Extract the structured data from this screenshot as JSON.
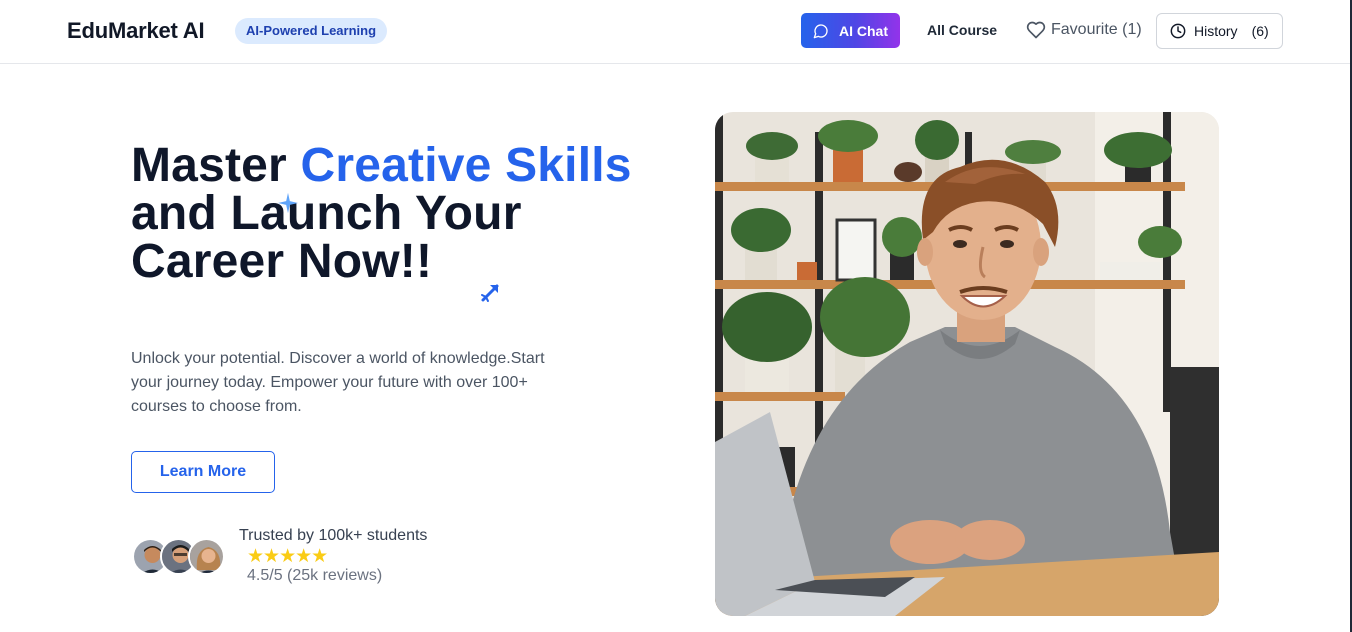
{
  "nav": {
    "brand": "EduMarket AI",
    "tagline": "AI-Powered Learning",
    "ai_chat_label": "AI Chat",
    "all_course_label": "All Course",
    "favourite_label": "Favourite (1)",
    "history_label": "History",
    "history_count": "(6)"
  },
  "hero": {
    "headline_part1": "Master ",
    "headline_accent": "Creative Skills",
    "headline_part2": "and Launch Your Career Now!!",
    "subtext": "Unlock your potential. Discover a world of knowledge.Start your journey today. Empower your future with over 100+ courses to choose from.",
    "cta_label": "Learn More"
  },
  "trust": {
    "title": "Trusted by 100k+ students",
    "stars": "★★★★★",
    "rating_value": 4.5,
    "rating_text": "4.5/5 (25k reviews)"
  },
  "icons": {
    "chat": "chat-bubble-icon",
    "favourite": "heart-icon",
    "history": "clock-icon",
    "sparkle": "sparkle-icon",
    "arrow": "arrow-up-right-icon"
  },
  "colors": {
    "accent": "#2563eb",
    "ai_chat_gradient_start": "#2563eb",
    "ai_chat_gradient_end": "#9333ea",
    "tagline_bg": "#dbeafe",
    "star": "#facc15"
  }
}
